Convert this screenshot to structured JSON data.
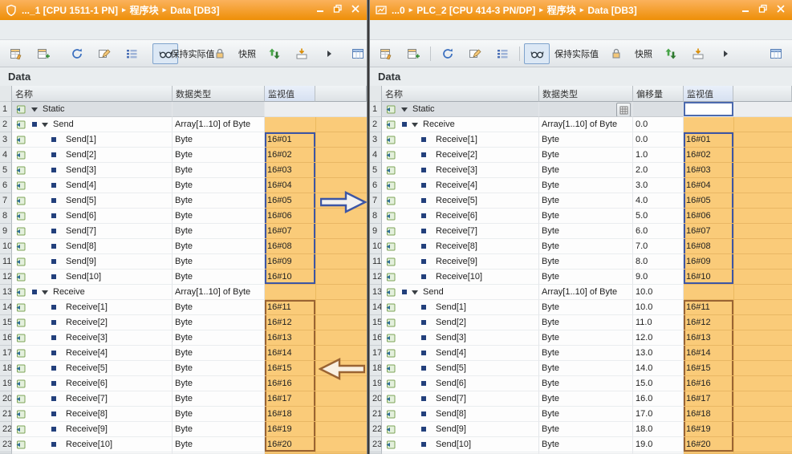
{
  "windows": [
    {
      "titlebar": {
        "icon": "shield-icon",
        "segments": [
          "..._1 [CPU 1511-1 PN]",
          "程序块",
          "Data [DB3]"
        ],
        "controls": [
          "minimize-icon",
          "restore-icon",
          "close-icon"
        ]
      },
      "toolbar": {
        "items": [
          {
            "t": "icon",
            "icon": "insert-row-icon"
          },
          {
            "t": "icon",
            "icon": "add-row-icon"
          },
          {
            "t": "sep"
          },
          {
            "t": "icon",
            "icon": "reset-values-icon"
          },
          {
            "t": "icon",
            "icon": "modify-icon"
          },
          {
            "t": "icon",
            "icon": "expand-list-icon"
          },
          {
            "t": "sep"
          },
          {
            "t": "icon",
            "icon": "monitor-all-icon",
            "pressed": true
          },
          {
            "t": "button",
            "label": "保持实际值",
            "icon": ""
          },
          {
            "t": "icon",
            "icon": "freeze-icon"
          },
          {
            "t": "button",
            "label": "快照",
            "icon": ""
          },
          {
            "t": "icon",
            "icon": "refresh-values-icon"
          },
          {
            "t": "icon",
            "icon": "load-values-icon"
          },
          {
            "t": "icon",
            "icon": "more-chevron-icon"
          },
          {
            "t": "spacer"
          },
          {
            "t": "icon",
            "icon": "open-editor-icon"
          }
        ]
      },
      "section_title": "Data",
      "table": {
        "headers": [
          "名称",
          "数据类型",
          "监视值"
        ],
        "rows": [
          {
            "num": "1",
            "kind": "group",
            "name": "Static",
            "type": "",
            "value": "",
            "selected": true
          },
          {
            "num": "2",
            "kind": "array",
            "name": "Send",
            "type": "Array[1..10] of Byte",
            "value": ""
          },
          {
            "num": "3",
            "kind": "child",
            "name": "Send[1]",
            "type": "Byte",
            "value": "16#01",
            "box": "blue"
          },
          {
            "num": "4",
            "kind": "child",
            "name": "Send[2]",
            "type": "Byte",
            "value": "16#02",
            "box": "blue"
          },
          {
            "num": "5",
            "kind": "child",
            "name": "Send[3]",
            "type": "Byte",
            "value": "16#03",
            "box": "blue"
          },
          {
            "num": "6",
            "kind": "child",
            "name": "Send[4]",
            "type": "Byte",
            "value": "16#04",
            "box": "blue"
          },
          {
            "num": "7",
            "kind": "child",
            "name": "Send[5]",
            "type": "Byte",
            "value": "16#05",
            "box": "blue"
          },
          {
            "num": "8",
            "kind": "child",
            "name": "Send[6]",
            "type": "Byte",
            "value": "16#06",
            "box": "blue"
          },
          {
            "num": "9",
            "kind": "child",
            "name": "Send[7]",
            "type": "Byte",
            "value": "16#07",
            "box": "blue"
          },
          {
            "num": "10",
            "kind": "child",
            "name": "Send[8]",
            "type": "Byte",
            "value": "16#08",
            "box": "blue"
          },
          {
            "num": "11",
            "kind": "child",
            "name": "Send[9]",
            "type": "Byte",
            "value": "16#09",
            "box": "blue"
          },
          {
            "num": "12",
            "kind": "child",
            "name": "Send[10]",
            "type": "Byte",
            "value": "16#10",
            "box": "blue"
          },
          {
            "num": "13",
            "kind": "array",
            "name": "Receive",
            "type": "Array[1..10] of Byte",
            "value": ""
          },
          {
            "num": "14",
            "kind": "child",
            "name": "Receive[1]",
            "type": "Byte",
            "value": "16#11",
            "box": "brown"
          },
          {
            "num": "15",
            "kind": "child",
            "name": "Receive[2]",
            "type": "Byte",
            "value": "16#12",
            "box": "brown"
          },
          {
            "num": "16",
            "kind": "child",
            "name": "Receive[3]",
            "type": "Byte",
            "value": "16#13",
            "box": "brown"
          },
          {
            "num": "17",
            "kind": "child",
            "name": "Receive[4]",
            "type": "Byte",
            "value": "16#14",
            "box": "brown"
          },
          {
            "num": "18",
            "kind": "child",
            "name": "Receive[5]",
            "type": "Byte",
            "value": "16#15",
            "box": "brown"
          },
          {
            "num": "19",
            "kind": "child",
            "name": "Receive[6]",
            "type": "Byte",
            "value": "16#16",
            "box": "brown"
          },
          {
            "num": "20",
            "kind": "child",
            "name": "Receive[7]",
            "type": "Byte",
            "value": "16#17",
            "box": "brown"
          },
          {
            "num": "21",
            "kind": "child",
            "name": "Receive[8]",
            "type": "Byte",
            "value": "16#18",
            "box": "brown"
          },
          {
            "num": "22",
            "kind": "child",
            "name": "Receive[9]",
            "type": "Byte",
            "value": "16#19",
            "box": "brown"
          },
          {
            "num": "23",
            "kind": "child",
            "name": "Receive[10]",
            "type": "Byte",
            "value": "16#20",
            "box": "brown"
          }
        ]
      }
    },
    {
      "titlebar": {
        "icon": "device-icon",
        "segments": [
          "...0",
          "PLC_2 [CPU 414-3 PN/DP]",
          "程序块",
          "Data [DB3]"
        ],
        "controls": [
          "minimize-icon",
          "restore-icon",
          "close-icon"
        ]
      },
      "toolbar": {
        "items": [
          {
            "t": "icon",
            "icon": "insert-row-icon"
          },
          {
            "t": "icon",
            "icon": "add-row-icon"
          },
          {
            "t": "sep"
          },
          {
            "t": "icon",
            "icon": "reset-values-icon"
          },
          {
            "t": "icon",
            "icon": "modify-icon"
          },
          {
            "t": "icon",
            "icon": "expand-list-icon"
          },
          {
            "t": "sep"
          },
          {
            "t": "icon",
            "icon": "monitor-all-icon",
            "pressed": true
          },
          {
            "t": "button",
            "label": "保持实际值",
            "icon": ""
          },
          {
            "t": "icon",
            "icon": "freeze-icon"
          },
          {
            "t": "button",
            "label": "快照",
            "icon": ""
          },
          {
            "t": "icon",
            "icon": "refresh-values-icon"
          },
          {
            "t": "icon",
            "icon": "load-values-icon"
          },
          {
            "t": "icon",
            "icon": "more-chevron-icon"
          },
          {
            "t": "spacer"
          },
          {
            "t": "icon",
            "icon": "open-editor-icon"
          }
        ]
      },
      "section_title": "Data",
      "table": {
        "headers": [
          "名称",
          "数据类型",
          "偏移量",
          "监视值"
        ],
        "rows": [
          {
            "num": "1",
            "kind": "group",
            "name": "Static",
            "type": "",
            "offset": "",
            "value": "",
            "selected": true,
            "type_button": true,
            "editing": true
          },
          {
            "num": "2",
            "kind": "array",
            "name": "Receive",
            "type": "Array[1..10] of Byte",
            "offset": "0.0",
            "value": ""
          },
          {
            "num": "3",
            "kind": "child",
            "name": "Receive[1]",
            "type": "Byte",
            "offset": "0.0",
            "value": "16#01",
            "box": "blue"
          },
          {
            "num": "4",
            "kind": "child",
            "name": "Receive[2]",
            "type": "Byte",
            "offset": "1.0",
            "value": "16#02",
            "box": "blue"
          },
          {
            "num": "5",
            "kind": "child",
            "name": "Receive[3]",
            "type": "Byte",
            "offset": "2.0",
            "value": "16#03",
            "box": "blue"
          },
          {
            "num": "6",
            "kind": "child",
            "name": "Receive[4]",
            "type": "Byte",
            "offset": "3.0",
            "value": "16#04",
            "box": "blue"
          },
          {
            "num": "7",
            "kind": "child",
            "name": "Receive[5]",
            "type": "Byte",
            "offset": "4.0",
            "value": "16#05",
            "box": "blue"
          },
          {
            "num": "8",
            "kind": "child",
            "name": "Receive[6]",
            "type": "Byte",
            "offset": "5.0",
            "value": "16#06",
            "box": "blue"
          },
          {
            "num": "9",
            "kind": "child",
            "name": "Receive[7]",
            "type": "Byte",
            "offset": "6.0",
            "value": "16#07",
            "box": "blue"
          },
          {
            "num": "10",
            "kind": "child",
            "name": "Receive[8]",
            "type": "Byte",
            "offset": "7.0",
            "value": "16#08",
            "box": "blue"
          },
          {
            "num": "11",
            "kind": "child",
            "name": "Receive[9]",
            "type": "Byte",
            "offset": "8.0",
            "value": "16#09",
            "box": "blue"
          },
          {
            "num": "12",
            "kind": "child",
            "name": "Receive[10]",
            "type": "Byte",
            "offset": "9.0",
            "value": "16#10",
            "box": "blue"
          },
          {
            "num": "13",
            "kind": "array",
            "name": "Send",
            "type": "Array[1..10] of Byte",
            "offset": "10.0",
            "value": ""
          },
          {
            "num": "14",
            "kind": "child",
            "name": "Send[1]",
            "type": "Byte",
            "offset": "10.0",
            "value": "16#11",
            "box": "brown"
          },
          {
            "num": "15",
            "kind": "child",
            "name": "Send[2]",
            "type": "Byte",
            "offset": "11.0",
            "value": "16#12",
            "box": "brown"
          },
          {
            "num": "16",
            "kind": "child",
            "name": "Send[3]",
            "type": "Byte",
            "offset": "12.0",
            "value": "16#13",
            "box": "brown"
          },
          {
            "num": "17",
            "kind": "child",
            "name": "Send[4]",
            "type": "Byte",
            "offset": "13.0",
            "value": "16#14",
            "box": "brown"
          },
          {
            "num": "18",
            "kind": "child",
            "name": "Send[5]",
            "type": "Byte",
            "offset": "14.0",
            "value": "16#15",
            "box": "brown"
          },
          {
            "num": "19",
            "kind": "child",
            "name": "Send[6]",
            "type": "Byte",
            "offset": "15.0",
            "value": "16#16",
            "box": "brown"
          },
          {
            "num": "20",
            "kind": "child",
            "name": "Send[7]",
            "type": "Byte",
            "offset": "16.0",
            "value": "16#17",
            "box": "brown"
          },
          {
            "num": "21",
            "kind": "child",
            "name": "Send[8]",
            "type": "Byte",
            "offset": "17.0",
            "value": "16#18",
            "box": "brown"
          },
          {
            "num": "22",
            "kind": "child",
            "name": "Send[9]",
            "type": "Byte",
            "offset": "18.0",
            "value": "16#19",
            "box": "brown"
          },
          {
            "num": "23",
            "kind": "child",
            "name": "Send[10]",
            "type": "Byte",
            "offset": "19.0",
            "value": "16#20",
            "box": "brown"
          }
        ]
      }
    }
  ],
  "annotations": {
    "transfer_arrow_right": {
      "color": "#3D56A5",
      "direction": "right"
    },
    "transfer_arrow_left": {
      "color": "#9A6433",
      "direction": "left"
    },
    "highlight_box_blue": "#3D56A5",
    "highlight_box_brown": "#9A6433",
    "monitor_column_color": "#FACB79",
    "titlebar_color": "#EE8F07"
  }
}
